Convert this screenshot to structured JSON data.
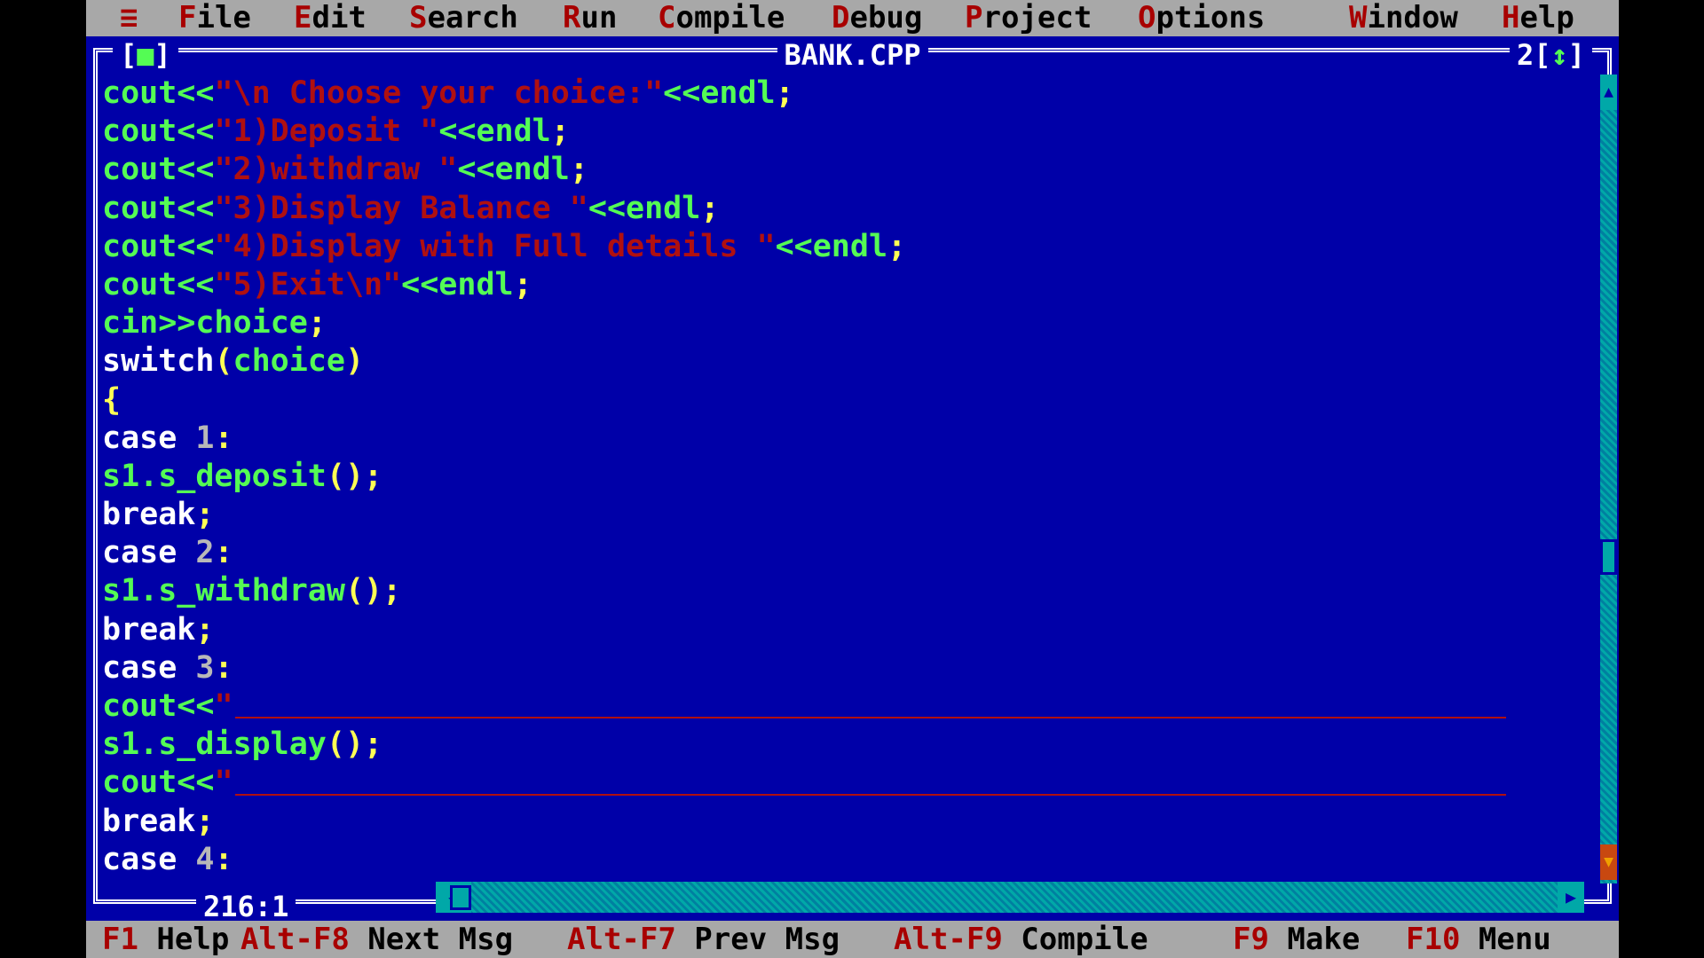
{
  "menu": {
    "system": "≡",
    "items": [
      {
        "hot": "F",
        "rest": "ile"
      },
      {
        "hot": "E",
        "rest": "dit"
      },
      {
        "hot": "S",
        "rest": "earch"
      },
      {
        "hot": "R",
        "rest": "un"
      },
      {
        "hot": "C",
        "rest": "ompile"
      },
      {
        "hot": "D",
        "rest": "ebug"
      },
      {
        "hot": "P",
        "rest": "roject"
      },
      {
        "hot": "O",
        "rest": "ptions"
      },
      {
        "hot": "W",
        "rest": "indow"
      },
      {
        "hot": "H",
        "rest": "elp"
      }
    ]
  },
  "window": {
    "title": "BANK.CPP",
    "close_open": "[",
    "close_glyph": "■",
    "close_end": "]",
    "number": "2",
    "zoom_open": "[",
    "zoom_glyph": "↕",
    "zoom_end": "]",
    "cursor_position": "216:1"
  },
  "code": [
    [
      [
        "id",
        "cout<<"
      ],
      [
        "str",
        "\"\\n Choose your choice:\""
      ],
      [
        "id",
        "<<endl"
      ],
      [
        "punc",
        ";"
      ]
    ],
    [
      [
        "id",
        "cout<<"
      ],
      [
        "str",
        "\"1)Deposit \""
      ],
      [
        "id",
        "<<endl"
      ],
      [
        "punc",
        ";"
      ]
    ],
    [
      [
        "id",
        "cout<<"
      ],
      [
        "str",
        "\"2)withdraw \""
      ],
      [
        "id",
        "<<endl"
      ],
      [
        "punc",
        ";"
      ]
    ],
    [
      [
        "id",
        "cout<<"
      ],
      [
        "str",
        "\"3)Display Balance \""
      ],
      [
        "id",
        "<<endl"
      ],
      [
        "punc",
        ";"
      ]
    ],
    [
      [
        "id",
        "cout<<"
      ],
      [
        "str",
        "\"4)Display with Full details \""
      ],
      [
        "id",
        "<<endl"
      ],
      [
        "punc",
        ";"
      ]
    ],
    [
      [
        "id",
        "cout<<"
      ],
      [
        "str",
        "\"5)Exit\\n\""
      ],
      [
        "id",
        "<<endl"
      ],
      [
        "punc",
        ";"
      ]
    ],
    [
      [
        "id",
        "cin>>choice"
      ],
      [
        "punc",
        ";"
      ]
    ],
    [
      [
        "kw",
        "switch"
      ],
      [
        "punc",
        "("
      ],
      [
        "id",
        "choice"
      ],
      [
        "punc",
        ")"
      ]
    ],
    [
      [
        "punc",
        "{"
      ]
    ],
    [
      [
        "kw",
        "case "
      ],
      [
        "num",
        "1"
      ],
      [
        "punc",
        ":"
      ]
    ],
    [
      [
        "id",
        "s1.s_deposit"
      ],
      [
        "punc",
        "();"
      ]
    ],
    [
      [
        "kw",
        "break"
      ],
      [
        "punc",
        ";"
      ]
    ],
    [
      [
        "kw",
        "case "
      ],
      [
        "num",
        "2"
      ],
      [
        "punc",
        ":"
      ]
    ],
    [
      [
        "id",
        "s1.s_withdraw"
      ],
      [
        "punc",
        "();"
      ]
    ],
    [
      [
        "kw",
        "break"
      ],
      [
        "punc",
        ";"
      ]
    ],
    [
      [
        "kw",
        "case "
      ],
      [
        "num",
        "3"
      ],
      [
        "punc",
        ":"
      ]
    ],
    [
      [
        "id",
        "cout<<"
      ],
      [
        "str",
        "\""
      ]
    ],
    [
      [
        "id",
        "s1.s_display"
      ],
      [
        "punc",
        "();"
      ]
    ],
    [
      [
        "id",
        "cout<<"
      ],
      [
        "str",
        "\""
      ]
    ],
    [
      [
        "kw",
        "break"
      ],
      [
        "punc",
        ";"
      ]
    ],
    [
      [
        "kw",
        "case "
      ],
      [
        "num",
        "4"
      ],
      [
        "punc",
        ":"
      ]
    ]
  ],
  "status": [
    {
      "key": "F1",
      "label": " Help"
    },
    {
      "key": "Alt-F8",
      "label": " Next Msg"
    },
    {
      "key": "Alt-F7",
      "label": " Prev Msg"
    },
    {
      "key": "Alt-F9",
      "label": " Compile"
    },
    {
      "key": "F9",
      "label": " Make"
    },
    {
      "key": "F10",
      "label": " Menu"
    }
  ],
  "colors": {
    "background": "#0000a8",
    "menubar": "#a8a8a8",
    "hotkey": "#a80000",
    "identifier": "#54fc54",
    "string": "#b01010",
    "keyword": "#ffffff",
    "punctuation": "#ffff54",
    "number": "#b8b8b8"
  }
}
